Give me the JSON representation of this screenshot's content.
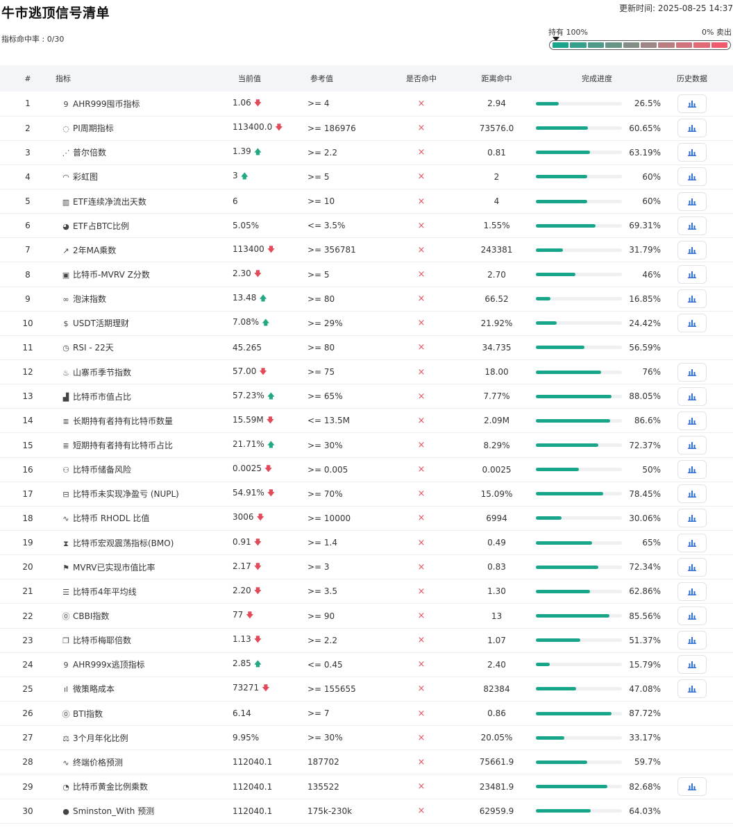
{
  "header": {
    "title": "牛市逃顶信号清单",
    "update_time": "更新时间: 2025-08-25 14:37",
    "hit_rate": "指标命中率 : 0/30"
  },
  "gauge": {
    "left_label": "持有 100%",
    "right_label": "0% 卖出",
    "segments": [
      "#1aa58a",
      "#35a08b",
      "#4f9a8a",
      "#6a9488",
      "#848d86",
      "#9e8684",
      "#b87e80",
      "#d0747b",
      "#e26a74",
      "#ef5d6c"
    ]
  },
  "columns": [
    "#",
    "指标",
    "当前值",
    "参考值",
    "是否命中",
    "距离命中",
    "完成进度",
    "历史数据"
  ],
  "colors": {
    "accent_green": "#17a689",
    "up": "#22a884",
    "down": "#e24a5a",
    "miss": "#e05561",
    "chart_icon": "#2d6fd2"
  },
  "rows": [
    {
      "idx": "1",
      "icon": "9",
      "name": "AHR999囤币指标",
      "current": "1.06",
      "trend": "down",
      "ref": ">= 4",
      "hit": "×",
      "distance": "2.94",
      "progress": 26.5,
      "pct": "26.5%",
      "history": true
    },
    {
      "idx": "2",
      "icon": "◌",
      "name": "PI周期指标",
      "current": "113400.0",
      "trend": "down",
      "ref": ">= 186976",
      "hit": "×",
      "distance": "73576.0",
      "progress": 60.65,
      "pct": "60.65%",
      "history": true
    },
    {
      "idx": "3",
      "icon": "⋰",
      "name": "普尔倍数",
      "current": "1.39",
      "trend": "up",
      "ref": ">= 2.2",
      "hit": "×",
      "distance": "0.81",
      "progress": 63.19,
      "pct": "63.19%",
      "history": true
    },
    {
      "idx": "4",
      "icon": "◠",
      "name": "彩虹图",
      "current": "3",
      "trend": "up",
      "ref": ">= 5",
      "hit": "×",
      "distance": "2",
      "progress": 60,
      "pct": "60%",
      "history": true
    },
    {
      "idx": "5",
      "icon": "▥",
      "name": "ETF连续净流出天数",
      "current": "6",
      "trend": "",
      "ref": ">= 10",
      "hit": "×",
      "distance": "4",
      "progress": 60,
      "pct": "60%",
      "history": true
    },
    {
      "idx": "6",
      "icon": "◕",
      "name": "ETF占BTC比例",
      "current": "5.05%",
      "trend": "",
      "ref": "<= 3.5%",
      "hit": "×",
      "distance": "1.55%",
      "progress": 69.31,
      "pct": "69.31%",
      "history": true
    },
    {
      "idx": "7",
      "icon": "↗",
      "name": "2年MA乘数",
      "current": "113400",
      "trend": "down",
      "ref": ">= 356781",
      "hit": "×",
      "distance": "243381",
      "progress": 31.79,
      "pct": "31.79%",
      "history": true
    },
    {
      "idx": "8",
      "icon": "▣",
      "name": "比特币-MVRV Z分数",
      "current": "2.30",
      "trend": "down",
      "ref": ">= 5",
      "hit": "×",
      "distance": "2.70",
      "progress": 46,
      "pct": "46%",
      "history": true
    },
    {
      "idx": "9",
      "icon": "∞",
      "name": "泡沫指数",
      "current": "13.48",
      "trend": "up",
      "ref": ">= 80",
      "hit": "×",
      "distance": "66.52",
      "progress": 16.85,
      "pct": "16.85%",
      "history": true
    },
    {
      "idx": "10",
      "icon": "$",
      "name": "USDT活期理财",
      "current": "7.08%",
      "trend": "up",
      "ref": ">= 29%",
      "hit": "×",
      "distance": "21.92%",
      "progress": 24.42,
      "pct": "24.42%",
      "history": true
    },
    {
      "idx": "11",
      "icon": "◷",
      "name": "RSI - 22天",
      "current": "45.265",
      "trend": "",
      "ref": ">= 80",
      "hit": "×",
      "distance": "34.735",
      "progress": 56.59,
      "pct": "56.59%",
      "history": false
    },
    {
      "idx": "12",
      "icon": "♨",
      "name": "山寨币季节指数",
      "current": "57.00",
      "trend": "down",
      "ref": ">= 75",
      "hit": "×",
      "distance": "18.00",
      "progress": 76,
      "pct": "76%",
      "history": true
    },
    {
      "idx": "13",
      "icon": "▟",
      "name": "比特币市值占比",
      "current": "57.23%",
      "trend": "up",
      "ref": ">= 65%",
      "hit": "×",
      "distance": "7.77%",
      "progress": 88.05,
      "pct": "88.05%",
      "history": true
    },
    {
      "idx": "14",
      "icon": "≣",
      "name": "长期持有者持有比特币数量",
      "current": "15.59M",
      "trend": "down",
      "ref": "<= 13.5M",
      "hit": "×",
      "distance": "2.09M",
      "progress": 86.6,
      "pct": "86.6%",
      "history": true
    },
    {
      "idx": "15",
      "icon": "≣",
      "name": "短期持有者持有比特币占比",
      "current": "21.71%",
      "trend": "up",
      "ref": ">= 30%",
      "hit": "×",
      "distance": "8.29%",
      "progress": 72.37,
      "pct": "72.37%",
      "history": true
    },
    {
      "idx": "16",
      "icon": "⚇",
      "name": "比特币储备风险",
      "current": "0.0025",
      "trend": "down",
      "ref": ">= 0.005",
      "hit": "×",
      "distance": "0.0025",
      "progress": 50,
      "pct": "50%",
      "history": true
    },
    {
      "idx": "17",
      "icon": "⊟",
      "name": "比特币未实现净盈亏 (NUPL)",
      "current": "54.91%",
      "trend": "down",
      "ref": ">= 70%",
      "hit": "×",
      "distance": "15.09%",
      "progress": 78.45,
      "pct": "78.45%",
      "history": true
    },
    {
      "idx": "18",
      "icon": "∿",
      "name": "比特币 RHODL 比值",
      "current": "3006",
      "trend": "down",
      "ref": ">= 10000",
      "hit": "×",
      "distance": "6994",
      "progress": 30.06,
      "pct": "30.06%",
      "history": true
    },
    {
      "idx": "19",
      "icon": "⧗",
      "name": "比特币宏观震荡指标(BMO)",
      "current": "0.91",
      "trend": "down",
      "ref": ">= 1.4",
      "hit": "×",
      "distance": "0.49",
      "progress": 65,
      "pct": "65%",
      "history": true
    },
    {
      "idx": "20",
      "icon": "⚑",
      "name": "MVRV已实现市值比率",
      "current": "2.17",
      "trend": "down",
      "ref": ">= 3",
      "hit": "×",
      "distance": "0.83",
      "progress": 72.34,
      "pct": "72.34%",
      "history": true
    },
    {
      "idx": "21",
      "icon": "☰",
      "name": "比特币4年平均线",
      "current": "2.20",
      "trend": "down",
      "ref": ">= 3.5",
      "hit": "×",
      "distance": "1.30",
      "progress": 62.86,
      "pct": "62.86%",
      "history": true
    },
    {
      "idx": "22",
      "icon": "⓪",
      "name": "CBBI指数",
      "current": "77",
      "trend": "down",
      "ref": ">= 90",
      "hit": "×",
      "distance": "13",
      "progress": 85.56,
      "pct": "85.56%",
      "history": true
    },
    {
      "idx": "23",
      "icon": "❐",
      "name": "比特币梅耶倍数",
      "current": "1.13",
      "trend": "down",
      "ref": ">= 2.2",
      "hit": "×",
      "distance": "1.07",
      "progress": 51.37,
      "pct": "51.37%",
      "history": true
    },
    {
      "idx": "24",
      "icon": "9",
      "name": "AHR999x逃顶指标",
      "current": "2.85",
      "trend": "up",
      "ref": "<= 0.45",
      "hit": "×",
      "distance": "2.40",
      "progress": 15.79,
      "pct": "15.79%",
      "history": true
    },
    {
      "idx": "25",
      "icon": "ıl",
      "name": "微策略成本",
      "current": "73271",
      "trend": "down",
      "ref": ">= 155655",
      "hit": "×",
      "distance": "82384",
      "progress": 47.08,
      "pct": "47.08%",
      "history": true
    },
    {
      "idx": "26",
      "icon": "⓪",
      "name": "BTI指数",
      "current": "6.14",
      "trend": "",
      "ref": ">= 7",
      "hit": "×",
      "distance": "0.86",
      "progress": 87.72,
      "pct": "87.72%",
      "history": false
    },
    {
      "idx": "27",
      "icon": "⚖",
      "name": "3个月年化比例",
      "current": "9.95%",
      "trend": "",
      "ref": ">= 30%",
      "hit": "×",
      "distance": "20.05%",
      "progress": 33.17,
      "pct": "33.17%",
      "history": false
    },
    {
      "idx": "28",
      "icon": "∿",
      "name": "终端价格预测",
      "current": "112040.1",
      "trend": "",
      "ref": "187702",
      "hit": "×",
      "distance": "75661.9",
      "progress": 59.7,
      "pct": "59.7%",
      "history": false
    },
    {
      "idx": "29",
      "icon": "◔",
      "name": "比特币黄金比例乘数",
      "current": "112040.1",
      "trend": "",
      "ref": "135522",
      "hit": "×",
      "distance": "23481.9",
      "progress": 82.68,
      "pct": "82.68%",
      "history": true
    },
    {
      "idx": "30",
      "icon": "●",
      "name": "Sminston_With 预测",
      "current": "112040.1",
      "trend": "",
      "ref": "175k-230k",
      "hit": "×",
      "distance": "62959.9",
      "progress": 64.03,
      "pct": "64.03%",
      "history": false
    }
  ]
}
